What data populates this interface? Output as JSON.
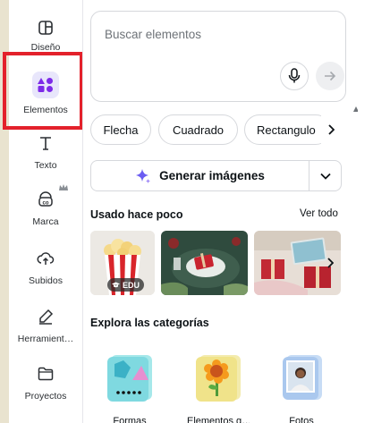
{
  "sidebar": {
    "items": [
      {
        "label": "Diseño",
        "icon": "design-icon"
      },
      {
        "label": "Elementos",
        "icon": "elements-icon",
        "active": true
      },
      {
        "label": "Texto",
        "icon": "text-icon"
      },
      {
        "label": "Marca",
        "icon": "brand-icon",
        "crown": true
      },
      {
        "label": "Subidos",
        "icon": "upload-icon"
      },
      {
        "label": "Herramient…",
        "icon": "tools-icon"
      },
      {
        "label": "Proyectos",
        "icon": "folder-icon"
      }
    ]
  },
  "search": {
    "placeholder": "Buscar elementos"
  },
  "chips": [
    "Flecha",
    "Cuadrado",
    "Rectangulo"
  ],
  "generate": {
    "label": "Generar imágenes"
  },
  "recent": {
    "title": "Usado hace poco",
    "see_all": "Ver todo",
    "badge": "EDU"
  },
  "categories": {
    "title": "Explora las categorías",
    "items": [
      "Formas",
      "Elementos g…",
      "Fotos"
    ]
  },
  "colors": {
    "accent": "#7d2ae8",
    "highlight": "#e3212b"
  }
}
